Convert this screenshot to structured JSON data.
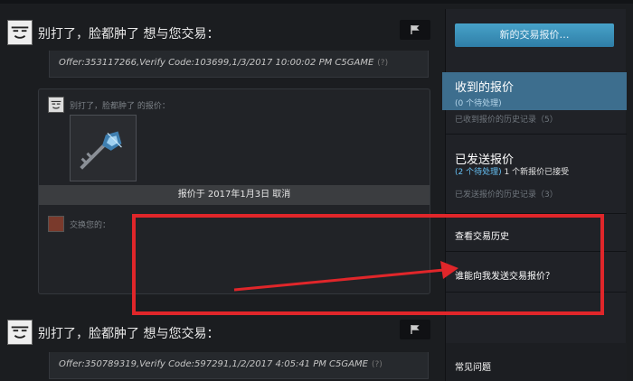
{
  "offers": [
    {
      "title": "别打了，脸都肿了 想与您交易：",
      "message": "Offer:353117266,Verify Code:103699,1/3/2017 10:00:02 PM C5GAME",
      "help": "(?)"
    },
    {
      "title": "别打了，脸都肿了 想与您交易：",
      "message": "Offer:350789319,Verify Code:597291,1/2/2017 4:05:41 PM C5GAME",
      "help": "(?)"
    }
  ],
  "offer_box": {
    "their_label": "别打了，脸都肿了 的报价：",
    "status": "报价于 2017年1月3日 取消",
    "your_label": "交换您的："
  },
  "sidebar": {
    "new_offer": "新的交易报价…",
    "received_title": "收到的报价",
    "received_pending": "(0 个待处理)",
    "received_history": "已收到报价的历史记录（5）",
    "sent_title": "已发送报价",
    "sent_pending": "(2 个待处理)",
    "sent_accepted": "1 个新报价已接受",
    "sent_history": "已发送报价的历史记录（3）",
    "trade_history": "查看交易历史",
    "who_can_send": "谁能向我发送交易报价？",
    "faq": "常见问题"
  },
  "colors": {
    "accent": "#66c0f4",
    "highlight": "#e0262a",
    "tab": "#3d6e8e"
  },
  "icons": [
    "avatar-icon",
    "flag-icon",
    "key-icon",
    "help-icon"
  ]
}
